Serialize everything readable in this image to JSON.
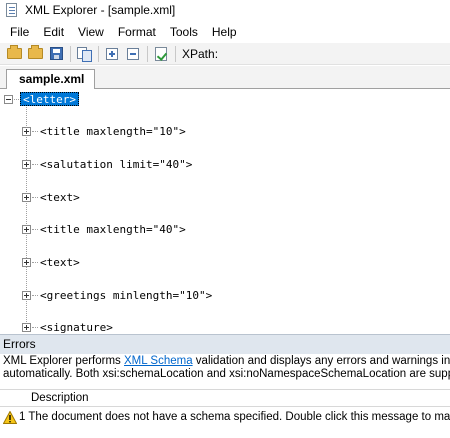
{
  "window": {
    "title": "XML Explorer - [sample.xml]"
  },
  "menu": [
    "File",
    "Edit",
    "View",
    "Format",
    "Tools",
    "Help"
  ],
  "toolbar": {
    "buttons": [
      "open-folder-icon",
      "open-recent-icon",
      "save-icon",
      "copy-icon",
      "expand-all-icon",
      "collapse-all-icon",
      "validate-icon"
    ],
    "xpath_label": "XPath:"
  },
  "tabs": [
    {
      "label": "sample.xml",
      "active": true
    }
  ],
  "tree": {
    "root": "<letter>",
    "children": [
      "<title maxlength=\"10\">",
      "<salutation limit=\"40\">",
      "<text>",
      "<title maxlength=\"40\">",
      "<text>",
      "<greetings minlength=\"10\">",
      "<signature>"
    ]
  },
  "errors": {
    "title": "Errors",
    "description_line1_prefix": "XML Explorer performs ",
    "description_link": "XML Schema",
    "description_line1_suffix": " validation and displays any errors and warnings in the list below",
    "description_line2": "automatically. Both xsi:schemaLocation and xsi:noNamespaceSchemaLocation are supported. You ca",
    "columns": [
      "Description"
    ],
    "rows": [
      {
        "icon": "warning-icon",
        "number": "1",
        "message": "The document does not have a schema specified.  Double click this message to manually assign a"
      }
    ]
  },
  "colors": {
    "selection": "#0078d7",
    "link": "#0066cc",
    "errors_header_bg": "#dfe6ee"
  }
}
